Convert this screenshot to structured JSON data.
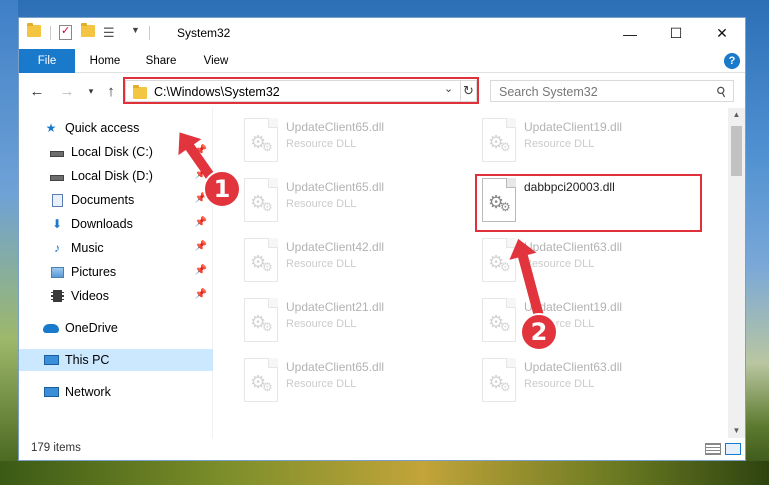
{
  "window": {
    "title": "System32",
    "controls": {
      "minimize": "—",
      "maximize": "☐",
      "close": "✕"
    }
  },
  "ribbon": {
    "tabs": [
      "File",
      "Home",
      "Share",
      "View"
    ],
    "help": "?"
  },
  "address": {
    "path": "C:\\Windows\\System32",
    "search_placeholder": "Search System32"
  },
  "sidebar": {
    "items": [
      {
        "label": "Quick access",
        "icon": "star-icon",
        "pinned": false
      },
      {
        "label": "Local Disk (C:)",
        "icon": "drive-icon",
        "pinned": true
      },
      {
        "label": "Local Disk (D:)",
        "icon": "drive-icon",
        "pinned": true
      },
      {
        "label": "Documents",
        "icon": "documents-icon",
        "pinned": true
      },
      {
        "label": "Downloads",
        "icon": "downloads-icon",
        "pinned": true
      },
      {
        "label": "Music",
        "icon": "music-icon",
        "pinned": true
      },
      {
        "label": "Pictures",
        "icon": "pictures-icon",
        "pinned": true
      },
      {
        "label": "Videos",
        "icon": "videos-icon",
        "pinned": true
      },
      {
        "label": "OneDrive",
        "icon": "onedrive-icon",
        "pinned": false
      },
      {
        "label": "This PC",
        "icon": "this-pc-icon",
        "pinned": false,
        "selected": true
      },
      {
        "label": "Network",
        "icon": "network-icon",
        "pinned": false
      }
    ]
  },
  "files": [
    {
      "name": "UpdateClient65.dll",
      "type": "Resource DLL"
    },
    {
      "name": "UpdateClient19.dll",
      "type": "Resource DLL"
    },
    {
      "name": "UpdateClient65.dll",
      "type": "Resource DLL"
    },
    {
      "name": "dabbpci20003.dll",
      "type": "",
      "highlighted": true
    },
    {
      "name": "UpdateClient42.dll",
      "type": "Resource DLL"
    },
    {
      "name": "UpdateClient63.dll",
      "type": "Resource DLL"
    },
    {
      "name": "UpdateClient21.dll",
      "type": "Resource DLL"
    },
    {
      "name": "UpdateClient19.dll",
      "type": "Resource DLL"
    },
    {
      "name": "UpdateClient65.dll",
      "type": "Resource DLL"
    },
    {
      "name": "UpdateClient63.dll",
      "type": "Resource DLL"
    }
  ],
  "status": {
    "item_count": "179 items"
  },
  "callouts": {
    "step1": "1",
    "step2": "2"
  },
  "colors": {
    "accent": "#1979ca",
    "highlight": "#e0303a",
    "selected_bg": "#cce8ff"
  }
}
